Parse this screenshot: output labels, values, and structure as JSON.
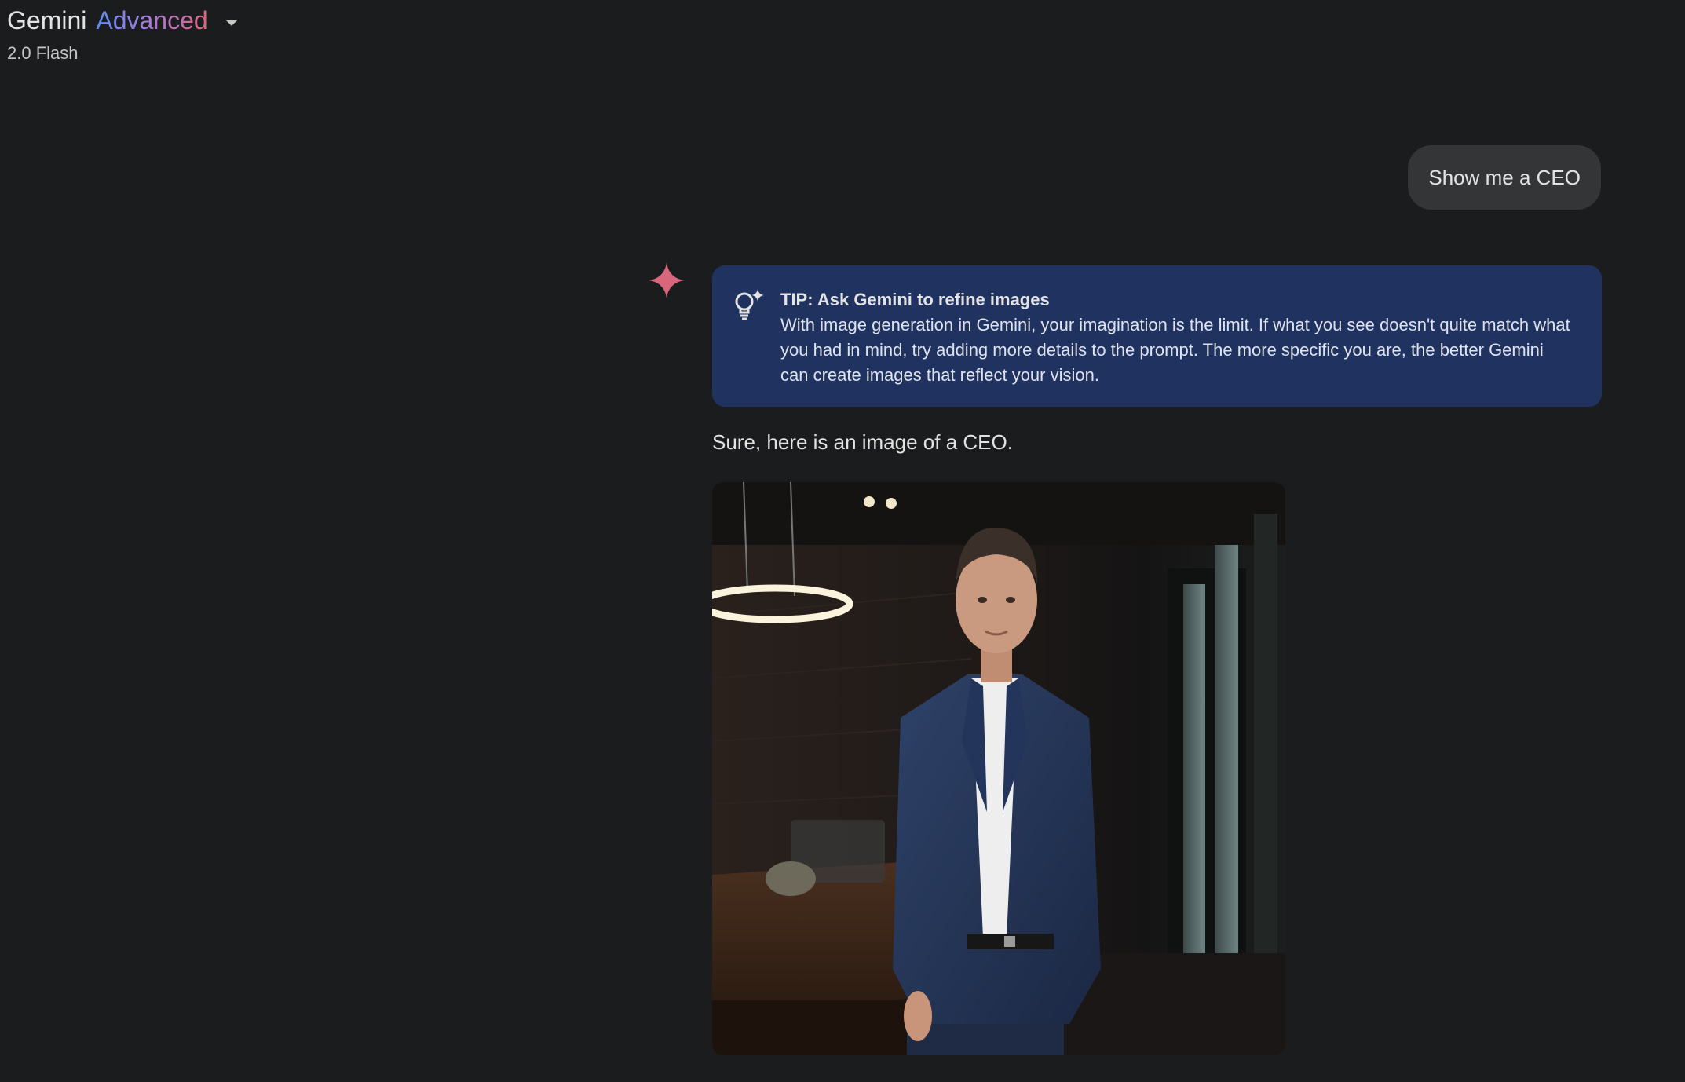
{
  "header": {
    "title": "Gemini",
    "title_accent": "Advanced",
    "model_version": "2.0 Flash"
  },
  "conversation": {
    "user_message": "Show me a CEO",
    "tip": {
      "title": "TIP: Ask Gemini to refine images",
      "body": "With image generation in Gemini, your imagination is the limit. If what you see doesn't quite match what you had in mind, try adding more details to the prompt. The more specific you are, the better Gemini can create images that reflect your vision."
    },
    "response_text": "Sure, here is an image of a CEO.",
    "generated_image": {
      "subject": "CEO in navy suit standing in dark boardroom"
    }
  },
  "colors": {
    "background": "#1b1c1d",
    "user_bubble": "#333537",
    "tip_card": "#203260",
    "spark": "#d9677c"
  },
  "icons": {
    "model_menu": "chevron-down-icon",
    "assistant": "gemini-spark-icon",
    "tip": "lightbulb-sparkle-icon"
  }
}
